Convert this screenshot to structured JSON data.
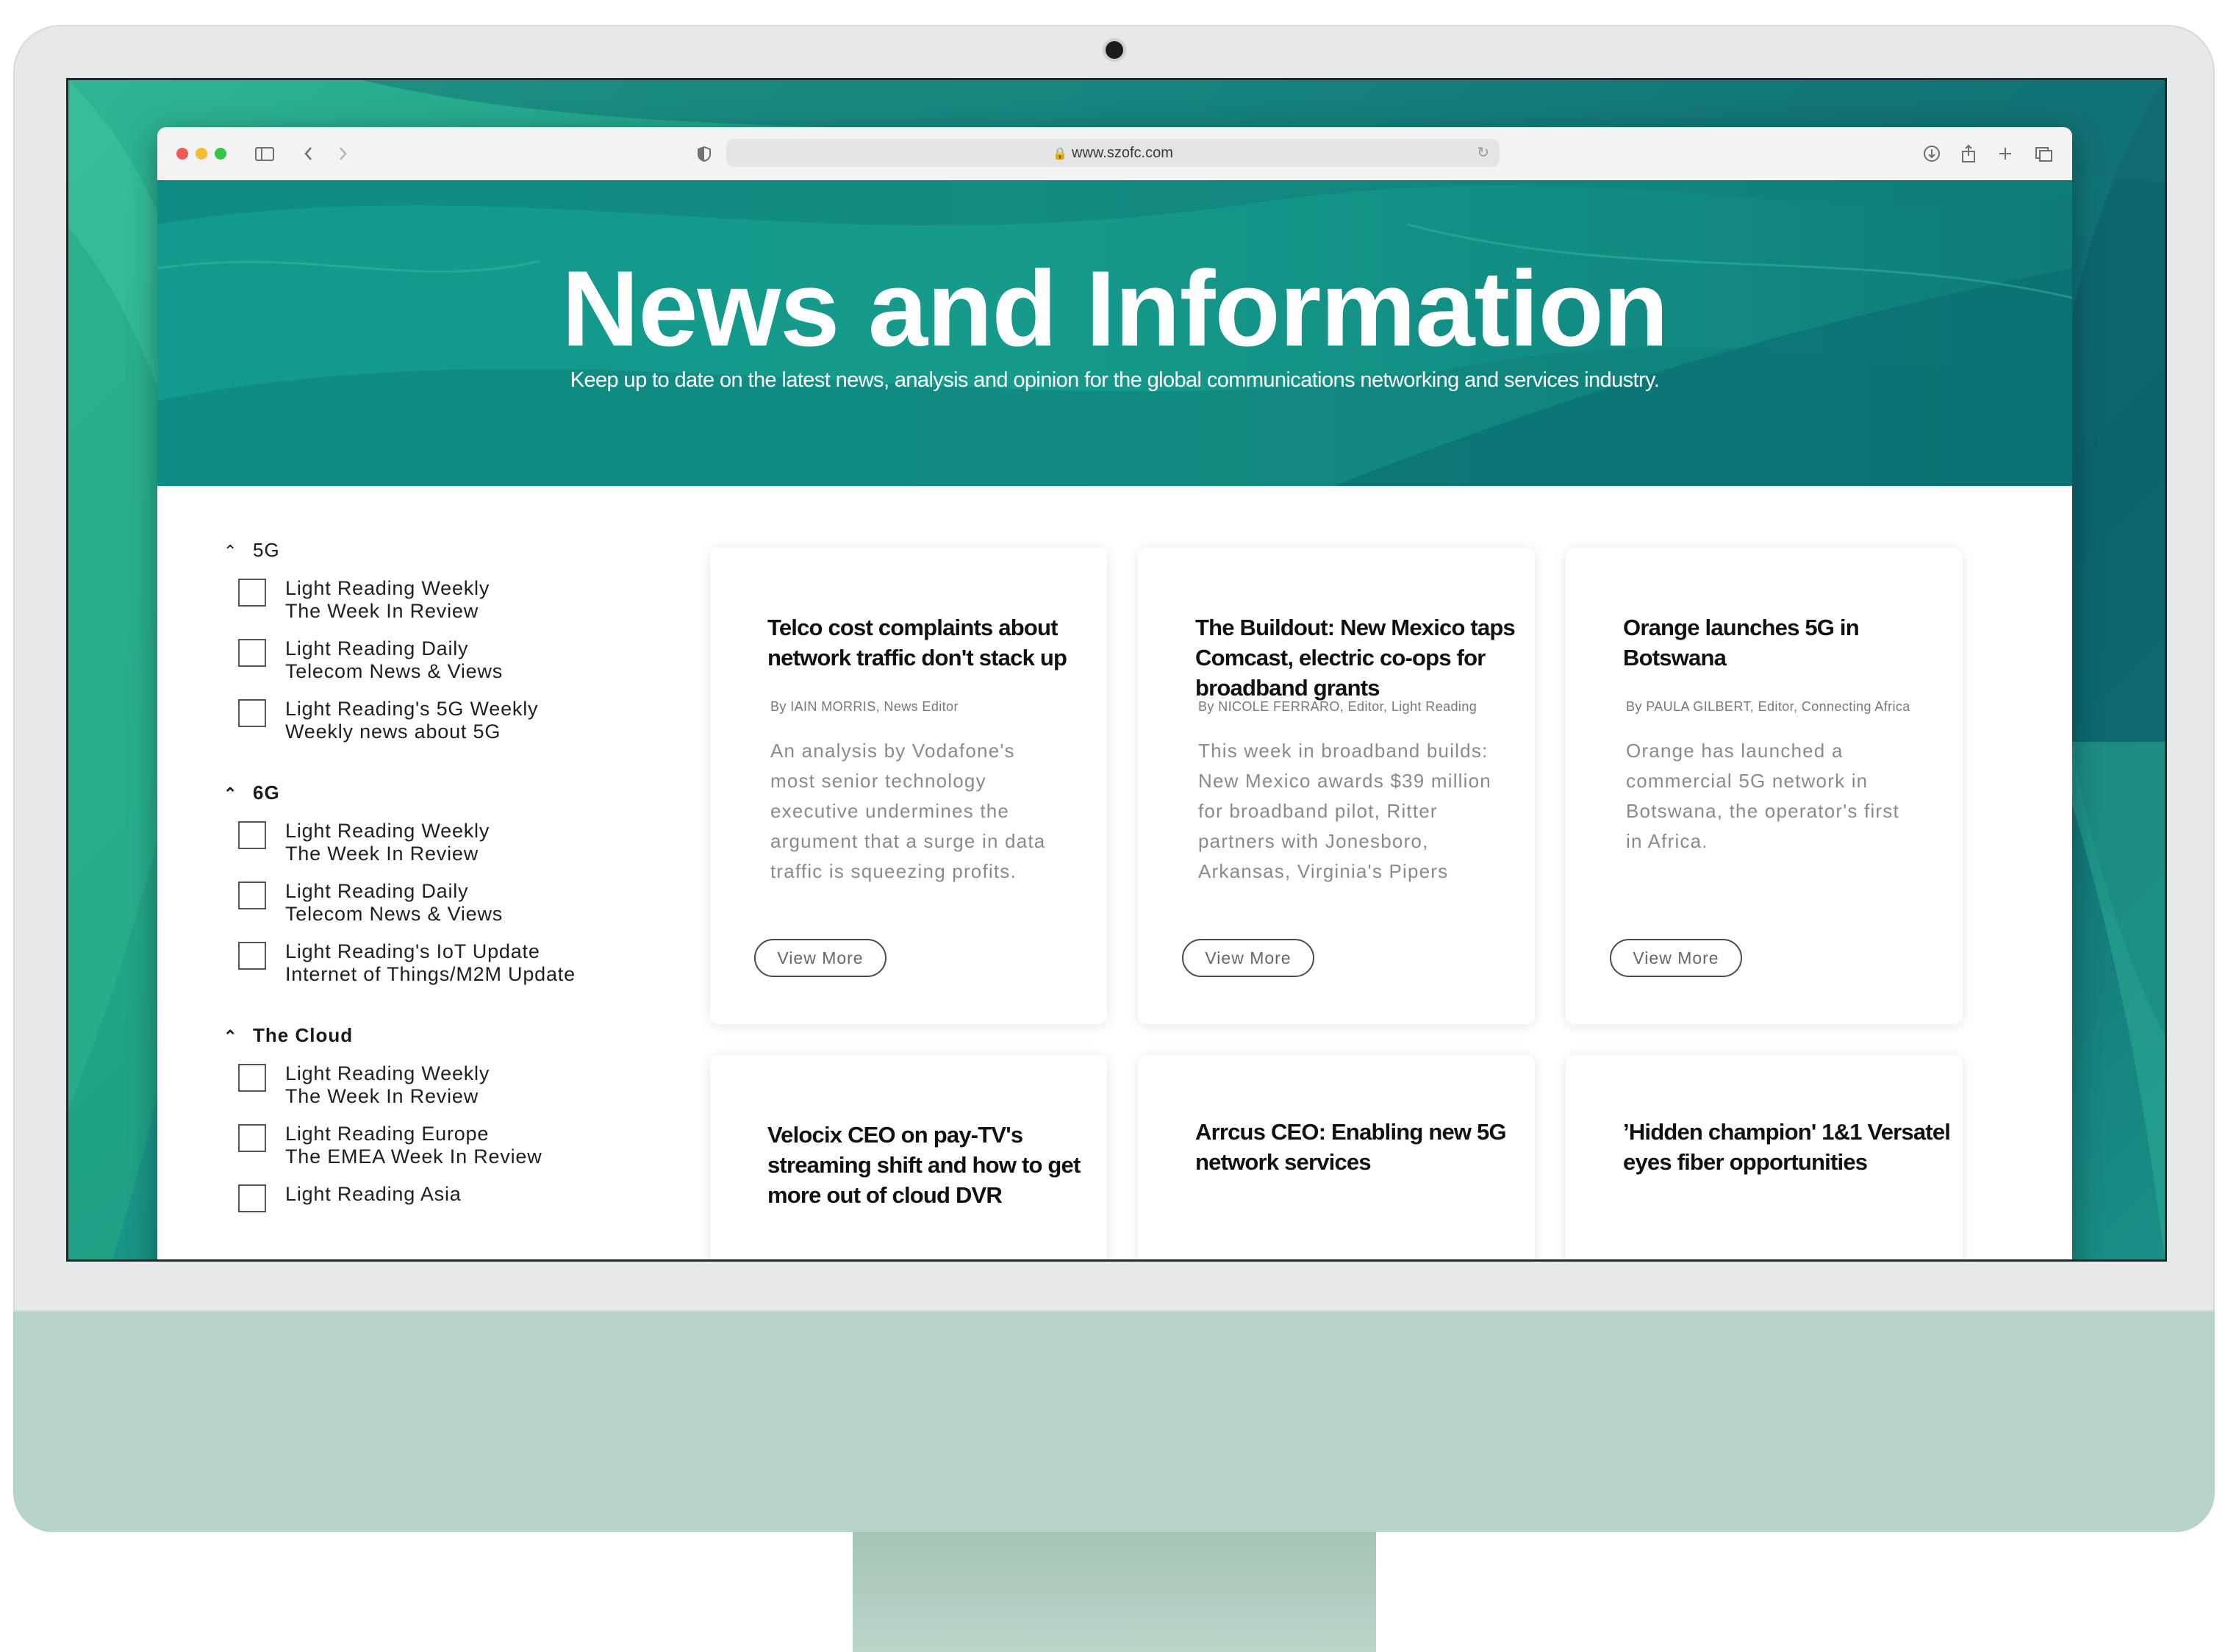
{
  "browser": {
    "url": "www.szofc.com"
  },
  "hero": {
    "title": "News and Information",
    "subtitle": "Keep up to date on the latest news, analysis and opinion for the global communications networking and services industry."
  },
  "sidebar": {
    "groups": [
      {
        "label": "5G",
        "items": [
          {
            "line1": "Light Reading Weekly",
            "line2": "The Week In Review"
          },
          {
            "line1": "Light Reading Daily",
            "line2": "Telecom News & Views"
          },
          {
            "line1": "Light Reading's 5G Weekly",
            "line2": "Weekly news about 5G"
          }
        ]
      },
      {
        "label": "6G",
        "items": [
          {
            "line1": "Light Reading Weekly",
            "line2": "The Week In Review"
          },
          {
            "line1": "Light Reading Daily",
            "line2": "Telecom News & Views"
          },
          {
            "line1": "Light Reading's IoT Update",
            "line2": "Internet of Things/M2M Update"
          }
        ]
      },
      {
        "label": "The Cloud",
        "items": [
          {
            "line1": "Light Reading Weekly",
            "line2": "The Week In Review"
          },
          {
            "line1": "Light Reading Europe",
            "line2": "The EMEA Week In Review"
          },
          {
            "line1": "Light Reading Asia",
            "line2": ""
          }
        ]
      }
    ]
  },
  "cards": [
    {
      "title": "Telco cost complaints about network traffic don't stack up",
      "byline": "By IAIN MORRIS, News Editor",
      "description": "An analysis by Vodafone's most senior technology executive undermines the argument that a surge in data traffic is squeezing profits.",
      "button": "View More"
    },
    {
      "title": "The Buildout: New Mexico taps Comcast, electric co-ops for broadband grants",
      "byline": "By NICOLE FERRARO, Editor, Light Reading",
      "description": "This week in broadband builds: New Mexico awards $39 million for broadband pilot, Ritter partners with Jonesboro, Arkansas, Virginia's Pipers",
      "button": "View More"
    },
    {
      "title": "Orange launches 5G in Botswana",
      "byline": "By PAULA GILBERT, Editor, Connecting Africa",
      "description": "Orange has launched a commercial 5G network in Botswana, the operator's first in Africa.",
      "button": "View More"
    },
    {
      "title": "Velocix CEO on pay-TV's streaming shift and how to get more out of cloud DVR",
      "byline": "",
      "description": "",
      "button": ""
    },
    {
      "title": "Arrcus CEO: Enabling new 5G network services",
      "byline": "",
      "description": "",
      "button": ""
    },
    {
      "title": "’Hidden champion' 1&1 Versatel eyes fiber opportunities",
      "byline": "",
      "description": "",
      "button": ""
    }
  ],
  "colors": {
    "accent": "#14998b",
    "traffic_red": "#ee5b52",
    "traffic_yellow": "#f5bc2f",
    "traffic_green": "#33c748",
    "chin": "#b6d4c7"
  }
}
